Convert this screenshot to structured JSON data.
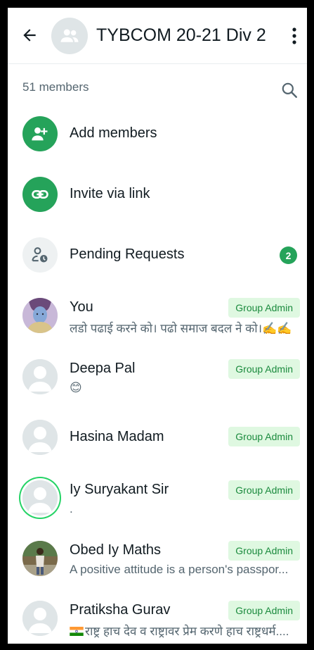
{
  "header": {
    "title": "TYBCOM 20-21 Div 2",
    "back_icon": "arrow-back-icon",
    "avatar_icon": "group-icon",
    "menu_icon": "more-vert-icon"
  },
  "members_count": "51 members",
  "actions": {
    "add_members": "Add members",
    "invite_link": "Invite via link",
    "pending_requests": "Pending Requests",
    "pending_count": "2"
  },
  "members": [
    {
      "name": "You",
      "status": "लडो पढाई करने को। पढो समाज बदल ने को।✍️✍️",
      "role": "Group Admin"
    },
    {
      "name": "Deepa Pal",
      "status": "😊",
      "role": "Group Admin"
    },
    {
      "name": "Hasina Madam",
      "status": "",
      "role": "Group Admin"
    },
    {
      "name": "Iy Suryakant Sir",
      "status": ".",
      "role": "Group Admin"
    },
    {
      "name": "Obed Iy Maths",
      "status": "A positive attitude is a person's passpor...",
      "role": "Group Admin"
    },
    {
      "name": "Pratiksha Gurav",
      "status": "राष्ट्र हाच देव व राष्ट्रावर प्रेम करणे हाच राष्ट्रधर्म....",
      "role": "Group Admin"
    }
  ],
  "colors": {
    "accent": "#25a35a",
    "admin_badge_bg": "#dff8e1",
    "admin_badge_text": "#1a8a3d",
    "secondary_text": "#54656f"
  }
}
